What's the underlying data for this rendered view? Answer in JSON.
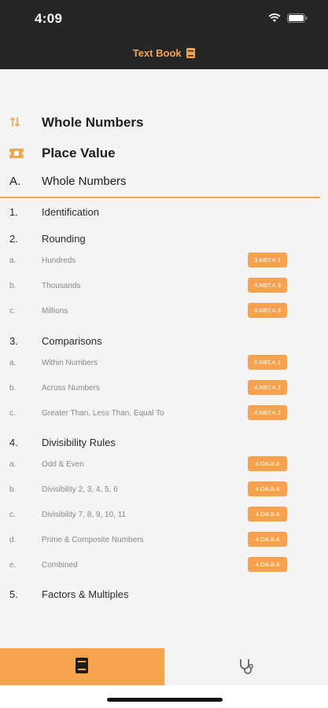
{
  "status": {
    "time": "4:09"
  },
  "nav": {
    "title": "Text Book"
  },
  "headers": [
    {
      "label": "Whole Numbers",
      "icon": "sort-arrows-icon"
    },
    {
      "label": "Place Value",
      "icon": "ticket-icon"
    }
  ],
  "section": {
    "letter": "A.",
    "title": "Whole Numbers"
  },
  "rows": [
    {
      "num": "1.",
      "label": "Identification",
      "badge": ""
    },
    {
      "num": "2.",
      "label": "Rounding",
      "badge": ""
    },
    {
      "num": "a.",
      "label": "Hundreds",
      "badge": "3.NBT.A.1"
    },
    {
      "num": "b.",
      "label": "Thousands",
      "badge": "4.NBT.A.3"
    },
    {
      "num": "c.",
      "label": "Millions",
      "badge": "4.NBT.A.3"
    },
    {
      "num": "3.",
      "label": "Comparisons",
      "badge": ""
    },
    {
      "num": "a.",
      "label": "Within Numbers",
      "badge": "5.NBT.A.1"
    },
    {
      "num": "b.",
      "label": "Across Numbers",
      "badge": "4.NBT.A.2"
    },
    {
      "num": "c.",
      "label": "Greater Than, Less Than, Equal To",
      "badge": "4.NBT.A.2"
    },
    {
      "num": "4.",
      "label": "Divisibility Rules",
      "badge": ""
    },
    {
      "num": "a.",
      "label": "Odd & Even",
      "badge": "4.OA.B.4"
    },
    {
      "num": "b.",
      "label": "Divisibility 2, 3, 4, 5, 6",
      "badge": "4.OA.B.4"
    },
    {
      "num": "c.",
      "label": "Divisibility 7, 8, 9, 10, 11",
      "badge": "4.OA.B.4"
    },
    {
      "num": "d.",
      "label": "Prime & Composite Numbers",
      "badge": "4.OA.B.4"
    },
    {
      "num": "e.",
      "label": "Combined",
      "badge": "4.OA.B.4"
    },
    {
      "num": "5.",
      "label": "Factors & Multiples",
      "badge": ""
    }
  ],
  "tabs": [
    {
      "icon": "book-icon",
      "active": true
    },
    {
      "icon": "stethoscope-icon",
      "active": false
    }
  ],
  "colors": {
    "accent": "#f7a24e",
    "bar": "#262626"
  }
}
